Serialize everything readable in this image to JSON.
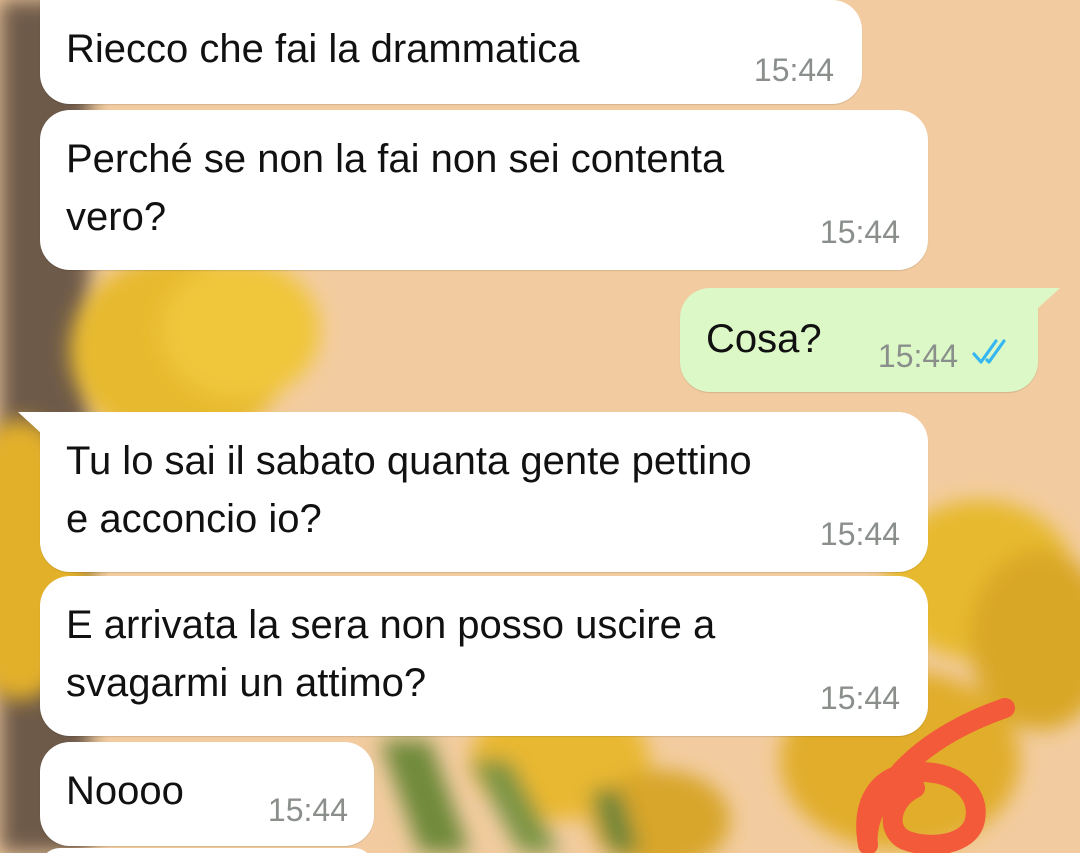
{
  "chat": {
    "messages": [
      {
        "direction": "incoming",
        "text": "Riecco che fai la drammatica",
        "time": "15:44"
      },
      {
        "direction": "incoming",
        "text": "Perché se non la fai non sei contenta\nvero?",
        "time": "15:44"
      },
      {
        "direction": "outgoing",
        "text": "Cosa?",
        "time": "15:44",
        "status_icon": "double-check-read-icon",
        "status_color": "#34b7f1"
      },
      {
        "direction": "incoming",
        "text": "Tu lo sai il sabato quanta gente pettino\ne acconcio io?",
        "time": "15:44"
      },
      {
        "direction": "incoming",
        "text": "E arrivata la sera non posso uscire a\nsvagarmi un attimo?",
        "time": "15:44"
      },
      {
        "direction": "incoming",
        "text": "Noooo",
        "time": "15:44"
      }
    ]
  },
  "colors": {
    "incoming_bubble": "#ffffff",
    "outgoing_bubble": "#dcf8c6",
    "timestamp": "#8a8f8c",
    "read_ticks": "#34b7f1",
    "annotation": "#f25a3a"
  }
}
